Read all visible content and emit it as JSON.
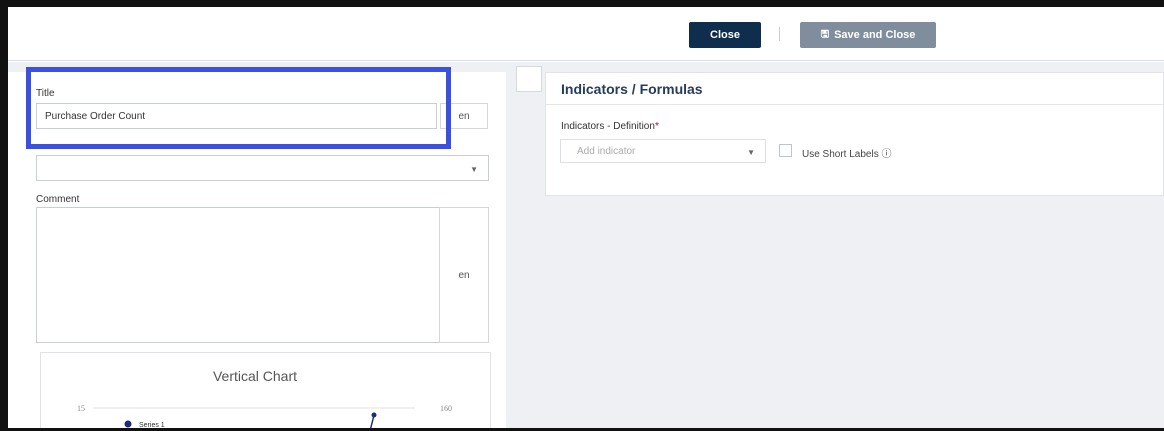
{
  "toolbar": {
    "close_label": "Close",
    "save_close_label": "Save and Close"
  },
  "form": {
    "title_label": "Title",
    "title_value": "Purchase Order Count",
    "title_lang": "en",
    "comment_label": "Comment",
    "comment_lang": "en"
  },
  "chart_preview": {
    "title": "Vertical Chart",
    "y_left_tick": "15",
    "y_right_tick": "160",
    "legend_series": "Series 1",
    "series_color": "#1f2a7a"
  },
  "indicators": {
    "panel_title": "Indicators / Formulas",
    "definition_label": "Indicators - Definition",
    "required_mark": "*",
    "add_placeholder": "Add indicator",
    "short_labels": "Use Short Labels",
    "info_icon": "ⓘ"
  },
  "colors": {
    "primary": "#0f2d4d",
    "secondary": "#7f8d9c",
    "highlight": "#3b4fe0",
    "required": "#d0021b"
  }
}
